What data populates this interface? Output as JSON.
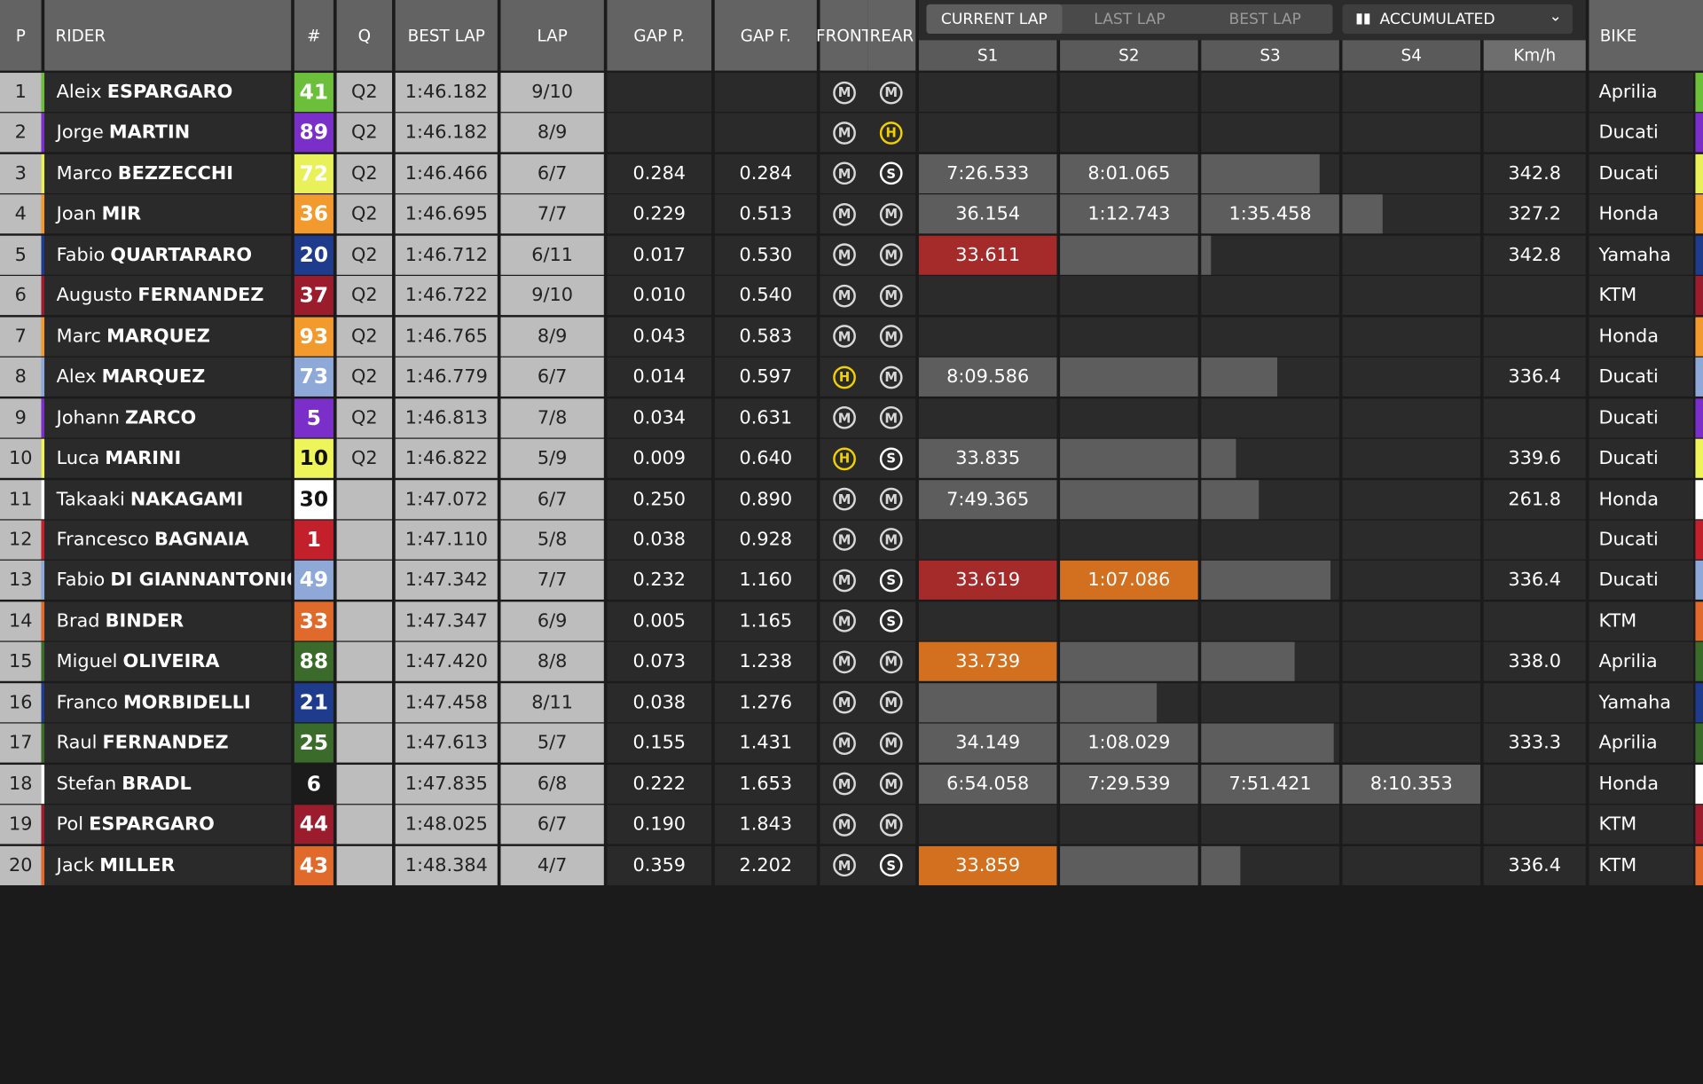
{
  "headers": {
    "pos": "P",
    "rider": "RIDER",
    "num": "#",
    "q": "Q",
    "best_lap": "BEST LAP",
    "lap": "LAP",
    "gap_p": "GAP P.",
    "gap_f": "GAP F.",
    "front": "FRONT",
    "rear": "REAR",
    "bike": "BIKE",
    "tabs": [
      "CURRENT LAP",
      "LAST LAP",
      "BEST LAP"
    ],
    "accumulated": "ACCUMULATED",
    "sectors": [
      "S1",
      "S2",
      "S3",
      "S4"
    ],
    "kmh": "Km/h"
  },
  "rows": [
    {
      "pos": "1",
      "first": "Aleix",
      "last": "ESPARGARO",
      "num": "41",
      "num_bg": "#6cbf3a",
      "num_fg": "#ffffff",
      "q": "Q2",
      "best": "1:46.182",
      "lap": "9/10",
      "gap_p": "",
      "gap_f": "",
      "front": "M",
      "rear": "M",
      "s1": "",
      "s2": "",
      "s3": "",
      "s4": "",
      "kmh": "",
      "bike": "Aprilia",
      "team_color": "#6cbf3a",
      "s1_bg": "",
      "s2_bg": "",
      "s3_fill": 0,
      "s4_fill": 0
    },
    {
      "pos": "2",
      "first": "Jorge",
      "last": "MARTIN",
      "num": "89",
      "num_bg": "#7b2fc9",
      "num_fg": "#ffffff",
      "q": "Q2",
      "best": "1:46.182",
      "lap": "8/9",
      "gap_p": "",
      "gap_f": "",
      "front": "M",
      "rear": "H",
      "s1": "",
      "s2": "",
      "s3": "",
      "s4": "",
      "kmh": "",
      "bike": "Ducati",
      "team_color": "#7b2fc9",
      "s1_bg": "",
      "s2_bg": "",
      "s3_fill": 0,
      "s4_fill": 0
    },
    {
      "pos": "3",
      "first": "Marco",
      "last": "BEZZECCHI",
      "num": "72",
      "num_bg": "#e8f05a",
      "num_fg": "#ffffff",
      "q": "Q2",
      "best": "1:46.466",
      "lap": "6/7",
      "gap_p": "0.284",
      "gap_f": "0.284",
      "front": "M",
      "rear": "S",
      "s1": "7:26.533",
      "s2": "8:01.065",
      "s3": "",
      "s4": "",
      "kmh": "342.8",
      "bike": "Ducati",
      "team_color": "#e8f05a",
      "s1_bg": "#5d5d5d",
      "s2_bg": "#5d5d5d",
      "s3_fill": 0.86,
      "s4_fill": 0
    },
    {
      "pos": "4",
      "first": "Joan",
      "last": "MIR",
      "num": "36",
      "num_bg": "#f39a2e",
      "num_fg": "#ffffff",
      "q": "Q2",
      "best": "1:46.695",
      "lap": "7/7",
      "gap_p": "0.229",
      "gap_f": "0.513",
      "front": "M",
      "rear": "M",
      "s1": "36.154",
      "s2": "1:12.743",
      "s3": "1:35.458",
      "s4": "",
      "kmh": "327.2",
      "bike": "Honda",
      "team_color": "#f39a2e",
      "s1_bg": "#5d5d5d",
      "s2_bg": "#5d5d5d",
      "s3_fill": 1,
      "s4_fill": 0.29
    },
    {
      "pos": "5",
      "first": "Fabio",
      "last": "QUARTARARO",
      "num": "20",
      "num_bg": "#1e3b8c",
      "num_fg": "#ffffff",
      "q": "Q2",
      "best": "1:46.712",
      "lap": "6/11",
      "gap_p": "0.017",
      "gap_f": "0.530",
      "front": "M",
      "rear": "M",
      "s1": "33.611",
      "s2": "",
      "s3": "",
      "s4": "",
      "kmh": "342.8",
      "bike": "Yamaha",
      "team_color": "#1e3b8c",
      "s1_bg": "#a52a2a",
      "s2_bg": "#5d5d5d",
      "s3_fill": 0.07,
      "s4_fill": 0
    },
    {
      "pos": "6",
      "first": "Augusto",
      "last": "FERNANDEZ",
      "num": "37",
      "num_bg": "#9b1c2c",
      "num_fg": "#ffffff",
      "q": "Q2",
      "best": "1:46.722",
      "lap": "9/10",
      "gap_p": "0.010",
      "gap_f": "0.540",
      "front": "M",
      "rear": "M",
      "s1": "",
      "s2": "",
      "s3": "",
      "s4": "",
      "kmh": "",
      "bike": "KTM",
      "team_color": "#9b1c2c",
      "s1_bg": "",
      "s2_bg": "",
      "s3_fill": 0,
      "s4_fill": 0
    },
    {
      "pos": "7",
      "first": "Marc",
      "last": "MARQUEZ",
      "num": "93",
      "num_bg": "#f39a2e",
      "num_fg": "#ffffff",
      "q": "Q2",
      "best": "1:46.765",
      "lap": "8/9",
      "gap_p": "0.043",
      "gap_f": "0.583",
      "front": "M",
      "rear": "M",
      "s1": "",
      "s2": "",
      "s3": "",
      "s4": "",
      "kmh": "",
      "bike": "Honda",
      "team_color": "#f39a2e",
      "s1_bg": "",
      "s2_bg": "",
      "s3_fill": 0,
      "s4_fill": 0
    },
    {
      "pos": "8",
      "first": "Alex",
      "last": "MARQUEZ",
      "num": "73",
      "num_bg": "#8ea8d8",
      "num_fg": "#ffffff",
      "q": "Q2",
      "best": "1:46.779",
      "lap": "6/7",
      "gap_p": "0.014",
      "gap_f": "0.597",
      "front": "H",
      "rear": "M",
      "s1": "8:09.586",
      "s2": "",
      "s3": "",
      "s4": "",
      "kmh": "336.4",
      "bike": "Ducati",
      "team_color": "#8ea8d8",
      "s1_bg": "#5d5d5d",
      "s2_bg": "#5d5d5d",
      "s3_fill": 0.55,
      "s4_fill": 0
    },
    {
      "pos": "9",
      "first": "Johann",
      "last": "ZARCO",
      "num": "5",
      "num_bg": "#7b2fc9",
      "num_fg": "#ffffff",
      "q": "Q2",
      "best": "1:46.813",
      "lap": "7/8",
      "gap_p": "0.034",
      "gap_f": "0.631",
      "front": "M",
      "rear": "M",
      "s1": "",
      "s2": "",
      "s3": "",
      "s4": "",
      "kmh": "",
      "bike": "Ducati",
      "team_color": "#7b2fc9",
      "s1_bg": "",
      "s2_bg": "",
      "s3_fill": 0,
      "s4_fill": 0
    },
    {
      "pos": "10",
      "first": "Luca",
      "last": "MARINI",
      "num": "10",
      "num_bg": "#eef55a",
      "num_fg": "#111111",
      "q": "Q2",
      "best": "1:46.822",
      "lap": "5/9",
      "gap_p": "0.009",
      "gap_f": "0.640",
      "front": "H",
      "rear": "S",
      "s1": "33.835",
      "s2": "",
      "s3": "",
      "s4": "",
      "kmh": "339.6",
      "bike": "Ducati",
      "team_color": "#eef55a",
      "s1_bg": "#5d5d5d",
      "s2_bg": "#5d5d5d",
      "s3_fill": 0.25,
      "s4_fill": 0
    },
    {
      "pos": "11",
      "first": "Takaaki",
      "last": "NAKAGAMI",
      "num": "30",
      "num_bg": "#ffffff",
      "num_fg": "#111111",
      "q": "",
      "best": "1:47.072",
      "lap": "6/7",
      "gap_p": "0.250",
      "gap_f": "0.890",
      "front": "M",
      "rear": "M",
      "s1": "7:49.365",
      "s2": "",
      "s3": "",
      "s4": "",
      "kmh": "261.8",
      "bike": "Honda",
      "team_color": "#ffffff",
      "s1_bg": "#5d5d5d",
      "s2_bg": "#5d5d5d",
      "s3_fill": 0.42,
      "s4_fill": 0
    },
    {
      "pos": "12",
      "first": "Francesco",
      "last": "BAGNAIA",
      "num": "1",
      "num_bg": "#c2202a",
      "num_fg": "#ffffff",
      "q": "",
      "best": "1:47.110",
      "lap": "5/8",
      "gap_p": "0.038",
      "gap_f": "0.928",
      "front": "M",
      "rear": "M",
      "s1": "",
      "s2": "",
      "s3": "",
      "s4": "",
      "kmh": "",
      "bike": "Ducati",
      "team_color": "#c2202a",
      "s1_bg": "",
      "s2_bg": "",
      "s3_fill": 0,
      "s4_fill": 0
    },
    {
      "pos": "13",
      "first": "Fabio",
      "last": "DI GIANNANTONIO",
      "num": "49",
      "num_bg": "#8ea8d8",
      "num_fg": "#ffffff",
      "q": "",
      "best": "1:47.342",
      "lap": "7/7",
      "gap_p": "0.232",
      "gap_f": "1.160",
      "front": "M",
      "rear": "S",
      "s1": "33.619",
      "s2": "1:07.086",
      "s3": "",
      "s4": "",
      "kmh": "336.4",
      "bike": "Ducati",
      "team_color": "#8ea8d8",
      "s1_bg": "#a52a2a",
      "s2_bg": "#d2701f",
      "s3_fill": 0.94,
      "s4_fill": 0
    },
    {
      "pos": "14",
      "first": "Brad",
      "last": "BINDER",
      "num": "33",
      "num_bg": "#e06a2c",
      "num_fg": "#ffffff",
      "q": "",
      "best": "1:47.347",
      "lap": "6/9",
      "gap_p": "0.005",
      "gap_f": "1.165",
      "front": "M",
      "rear": "S",
      "s1": "",
      "s2": "",
      "s3": "",
      "s4": "",
      "kmh": "",
      "bike": "KTM",
      "team_color": "#e06a2c",
      "s1_bg": "",
      "s2_bg": "",
      "s3_fill": 0,
      "s4_fill": 0
    },
    {
      "pos": "15",
      "first": "Miguel",
      "last": "OLIVEIRA",
      "num": "88",
      "num_bg": "#3a6b2a",
      "num_fg": "#ffffff",
      "q": "",
      "best": "1:47.420",
      "lap": "8/8",
      "gap_p": "0.073",
      "gap_f": "1.238",
      "front": "M",
      "rear": "M",
      "s1": "33.739",
      "s2": "",
      "s3": "",
      "s4": "",
      "kmh": "338.0",
      "bike": "Aprilia",
      "team_color": "#3a6b2a",
      "s1_bg": "#d2701f",
      "s2_bg": "#5d5d5d",
      "s3_fill": 0.68,
      "s4_fill": 0
    },
    {
      "pos": "16",
      "first": "Franco",
      "last": "MORBIDELLI",
      "num": "21",
      "num_bg": "#1e3b8c",
      "num_fg": "#ffffff",
      "q": "",
      "best": "1:47.458",
      "lap": "8/11",
      "gap_p": "0.038",
      "gap_f": "1.276",
      "front": "M",
      "rear": "M",
      "s1": "",
      "s2": "",
      "s3": "",
      "s4": "",
      "kmh": "",
      "bike": "Yamaha",
      "team_color": "#1e3b8c",
      "s1_bg": "#5d5d5d",
      "s2_bg": "#5d5d5d",
      "s2_fill": 0.7,
      "s3_fill": 0,
      "s4_fill": 0
    },
    {
      "pos": "17",
      "first": "Raul",
      "last": "FERNANDEZ",
      "num": "25",
      "num_bg": "#3a6b2a",
      "num_fg": "#ffffff",
      "q": "",
      "best": "1:47.613",
      "lap": "5/7",
      "gap_p": "0.155",
      "gap_f": "1.431",
      "front": "M",
      "rear": "M",
      "s1": "34.149",
      "s2": "1:08.029",
      "s3": "",
      "s4": "",
      "kmh": "333.3",
      "bike": "Aprilia",
      "team_color": "#3a6b2a",
      "s1_bg": "#5d5d5d",
      "s2_bg": "#5d5d5d",
      "s3_fill": 0.96,
      "s4_fill": 0
    },
    {
      "pos": "18",
      "first": "Stefan",
      "last": "BRADL",
      "num": "6",
      "num_bg": "#1b1b1b",
      "num_fg": "#ffffff",
      "q": "",
      "best": "1:47.835",
      "lap": "6/8",
      "gap_p": "0.222",
      "gap_f": "1.653",
      "front": "M",
      "rear": "M",
      "s1": "6:54.058",
      "s2": "7:29.539",
      "s3": "7:51.421",
      "s4": "8:10.353",
      "kmh": "",
      "bike": "Honda",
      "team_color": "#ffffff",
      "s1_bg": "#5d5d5d",
      "s2_bg": "#5d5d5d",
      "s3_fill": 1,
      "s4_fill": 1
    },
    {
      "pos": "19",
      "first": "Pol",
      "last": "ESPARGARO",
      "num": "44",
      "num_bg": "#9b1c2c",
      "num_fg": "#ffffff",
      "q": "",
      "best": "1:48.025",
      "lap": "6/7",
      "gap_p": "0.190",
      "gap_f": "1.843",
      "front": "M",
      "rear": "M",
      "s1": "",
      "s2": "",
      "s3": "",
      "s4": "",
      "kmh": "",
      "bike": "KTM",
      "team_color": "#9b1c2c",
      "s1_bg": "",
      "s2_bg": "",
      "s3_fill": 0,
      "s4_fill": 0
    },
    {
      "pos": "20",
      "first": "Jack",
      "last": "MILLER",
      "num": "43",
      "num_bg": "#e06a2c",
      "num_fg": "#ffffff",
      "q": "",
      "best": "1:48.384",
      "lap": "4/7",
      "gap_p": "0.359",
      "gap_f": "2.202",
      "front": "M",
      "rear": "S",
      "s1": "33.859",
      "s2": "",
      "s3": "",
      "s4": "",
      "kmh": "336.4",
      "bike": "KTM",
      "team_color": "#e06a2c",
      "s1_bg": "#d2701f",
      "s2_bg": "#5d5d5d",
      "s3_fill": 0.28,
      "s4_fill": 0
    }
  ]
}
